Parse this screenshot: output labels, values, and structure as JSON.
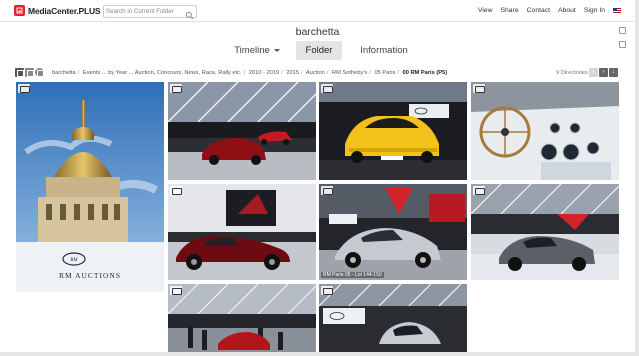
{
  "app": {
    "logo_text": "MediaCenter.PLUS",
    "search_placeholder": "Search in Current Folder",
    "nav": [
      "View",
      "Share",
      "Contact",
      "About",
      "Sign In"
    ]
  },
  "album": {
    "title": "barchetta",
    "tabs": [
      {
        "label": "Timeline",
        "active": false,
        "dropdown": true
      },
      {
        "label": "Folder",
        "active": true
      },
      {
        "label": "Information",
        "active": false
      }
    ]
  },
  "breadcrumb": {
    "items": [
      "barchetta",
      "Events ... by Year ... Auction, Concours, News, Race, Rally etc.",
      "2010 - 2019",
      "2015",
      "Auction",
      "RM Sotheby's",
      "05 Paris"
    ],
    "current": "00 RM Paris (P5)",
    "dir_count": "9 Directories"
  },
  "tiles": [
    {
      "name": "tile-rm-auctions-dome",
      "caption": "",
      "overlay_text": "RM AUCTIONS",
      "kind": "dome"
    },
    {
      "name": "tile-red-ferrari-hall",
      "caption": "",
      "kind": "hall-red"
    },
    {
      "name": "tile-yellow-ferrari",
      "caption": "",
      "kind": "yellow"
    },
    {
      "name": "tile-interior-dashboard",
      "caption": "",
      "kind": "interior"
    },
    {
      "name": "tile-dark-red-alfa",
      "caption": "",
      "kind": "alfa"
    },
    {
      "name": "tile-silver-porsche",
      "caption": "RM Paris 05 - Lot 144-150",
      "kind": "porsche"
    },
    {
      "name": "tile-grey-ferrari-hall",
      "caption": "",
      "kind": "grey"
    },
    {
      "name": "tile-hall-crowd",
      "caption": "",
      "kind": "crowd"
    },
    {
      "name": "tile-silver-aston",
      "caption": "",
      "kind": "aston"
    }
  ],
  "colors": {
    "brand": "#e4212b",
    "active_tab": "#e4e4e4"
  }
}
